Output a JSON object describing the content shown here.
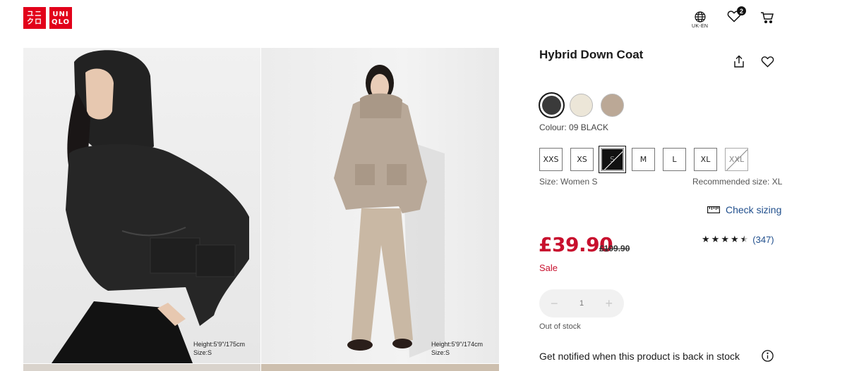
{
  "header": {
    "logo_top": "ユニ",
    "logo_bottom": "クロ",
    "logo_top_en": "UNI",
    "logo_bottom_en": "QLO",
    "language": "UK-EN",
    "wishlist_count": "2"
  },
  "gallery": {
    "image1_meta_line1": "Height:5'9\"/175cm",
    "image1_meta_line2": "Size:S",
    "image2_meta_line1": "Height:5'9\"/174cm",
    "image2_meta_line2": "Size:S"
  },
  "product": {
    "title": "Hybrid Down Coat",
    "colour_label": "Colour: 09 BLACK",
    "colours": [
      "#3a3a3a",
      "#ece6d8",
      "#bba896"
    ],
    "sizes": [
      "XXS",
      "XS",
      "S",
      "M",
      "L",
      "XL",
      "XXL"
    ],
    "selected_size": "S",
    "size_label": "Size: Women S",
    "recommended_size": "Recommended size: XL",
    "check_sizing": "Check sizing",
    "price": "£39.90",
    "original_price": "£109.90",
    "sale_label": "Sale",
    "rating": 4.5,
    "review_count": "(347)",
    "quantity": "1",
    "stock_status": "Out of stock",
    "notify_text": "Get notified when this product is back in stock"
  }
}
